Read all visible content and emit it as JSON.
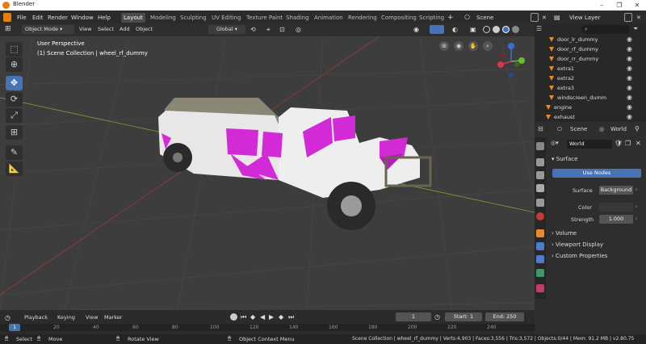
{
  "app": {
    "title": "Blender"
  },
  "topbar": {
    "menus": [
      "File",
      "Edit",
      "Render",
      "Window",
      "Help"
    ],
    "workspaces": [
      "Layout",
      "Modeling",
      "Sculpting",
      "UV Editing",
      "Texture Paint",
      "Shading",
      "Animation",
      "Rendering",
      "Compositing",
      "Scripting"
    ],
    "active_workspace": "Layout",
    "scene": "Scene",
    "view_layer": "View Layer"
  },
  "viewport_header": {
    "mode": "Object Mode",
    "menus": [
      "View",
      "Select",
      "Add",
      "Object"
    ],
    "orientation": "Global"
  },
  "viewport": {
    "perspective": "User Perspective",
    "collection_info": "(1) Scene Collection | wheel_rf_dummy"
  },
  "outliner": {
    "items": [
      "door_lr_dummy",
      "door_rf_dummy",
      "door_rr_dummy",
      "extra1",
      "extra2",
      "extra3",
      "windscreen_dumm",
      "engine",
      "exhaust"
    ]
  },
  "properties": {
    "scene_label": "Scene",
    "world_label": "World",
    "world_name": "World",
    "surface_section": "Surface",
    "use_nodes": "Use Nodes",
    "surface_label": "Surface",
    "surface_value": "Background",
    "color_label": "Color",
    "strength_label": "Strength",
    "strength_value": "1.000",
    "volume_section": "Volume",
    "viewport_display_section": "Viewport Display",
    "custom_properties_section": "Custom Properties"
  },
  "timeline": {
    "menus": [
      "Playback",
      "Keying",
      "View",
      "Marker"
    ],
    "current_frame": "1",
    "start_label": "Start:",
    "start": "1",
    "end_label": "End:",
    "end": "250",
    "ticks": [
      "20",
      "40",
      "60",
      "80",
      "100",
      "120",
      "140",
      "160",
      "180",
      "200",
      "220",
      "240"
    ]
  },
  "statusbar": {
    "select": "Select",
    "move": "Move",
    "rotate": "Rotate View",
    "context_menu": "Object Context Menu",
    "stats": "Scene Collection | wheel_rf_dummy | Verts:4,903 | Faces:3,556 | Tris:3,572 | Objects:0/44 | Mem: 91.2 MB | v2.80.75"
  },
  "colors": {
    "accent": "#4772b3",
    "magenta": "#d12ad6",
    "orange": "#e88a2b"
  }
}
